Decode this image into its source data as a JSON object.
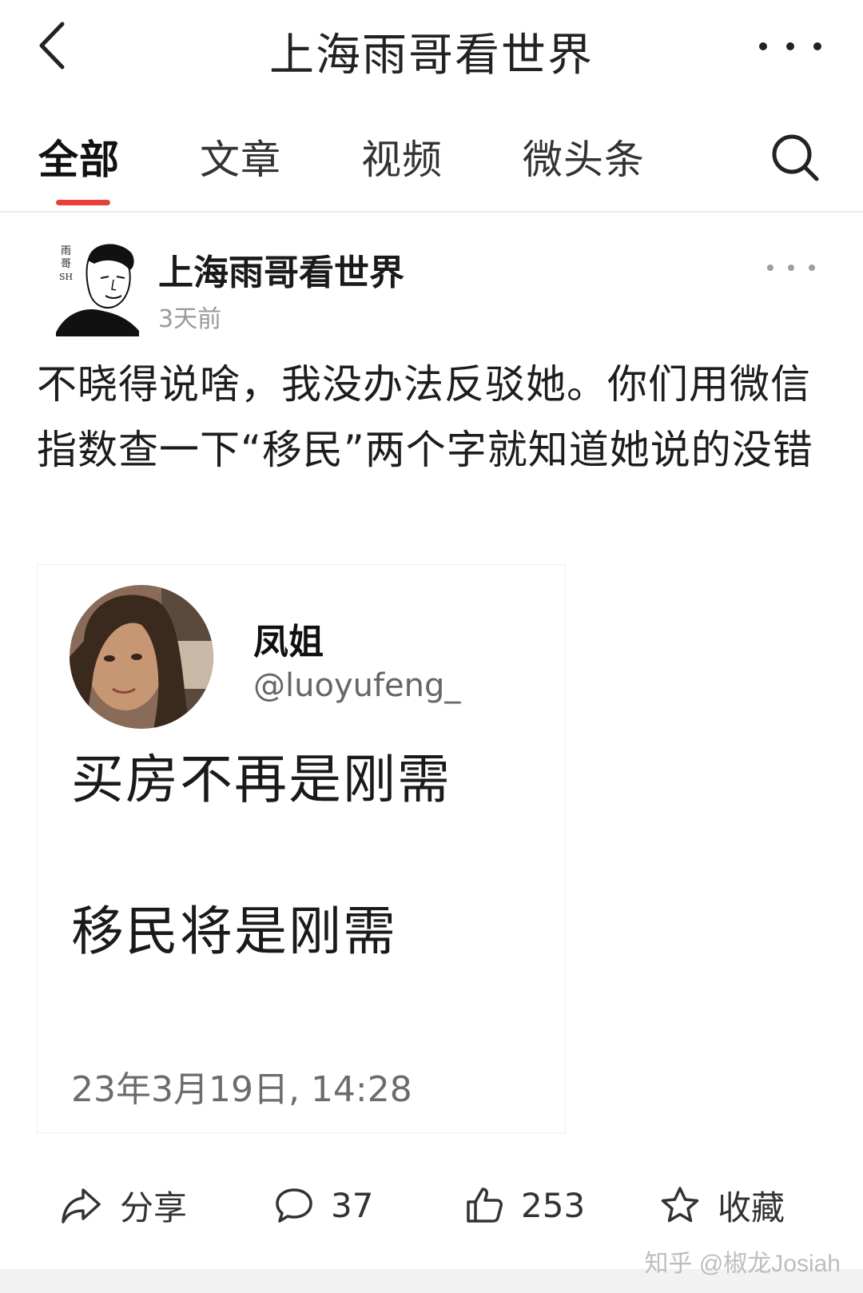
{
  "header": {
    "title": "上海雨哥看世界",
    "back_icon": "chevron-left-icon",
    "more_icon": "more-horizontal-icon"
  },
  "tabs": [
    {
      "label": "全部",
      "active": true
    },
    {
      "label": "文章",
      "active": false
    },
    {
      "label": "视频",
      "active": false
    },
    {
      "label": "微头条",
      "active": false
    }
  ],
  "search_icon": "search-icon",
  "post": {
    "author": "上海雨哥看世界",
    "avatar_text": "雨\n哥\nSH",
    "time": "3天前",
    "text": "不晓得说啥，我没办法反驳她。你们用微信指数查一下“移民”两个字就知道她说的没错"
  },
  "card": {
    "name": "凤姐",
    "handle": "@luoyufeng_",
    "line1": "买房不再是刚需",
    "line2": "移民将是刚需",
    "date": "23年3月19日, 14:28"
  },
  "actions": {
    "share": "分享",
    "comments": "37",
    "likes": "253",
    "favorite": "收藏"
  },
  "watermark": "知乎 @椒龙Josiah",
  "colors": {
    "accent": "#e8413b",
    "muted": "#9a9a9a"
  }
}
